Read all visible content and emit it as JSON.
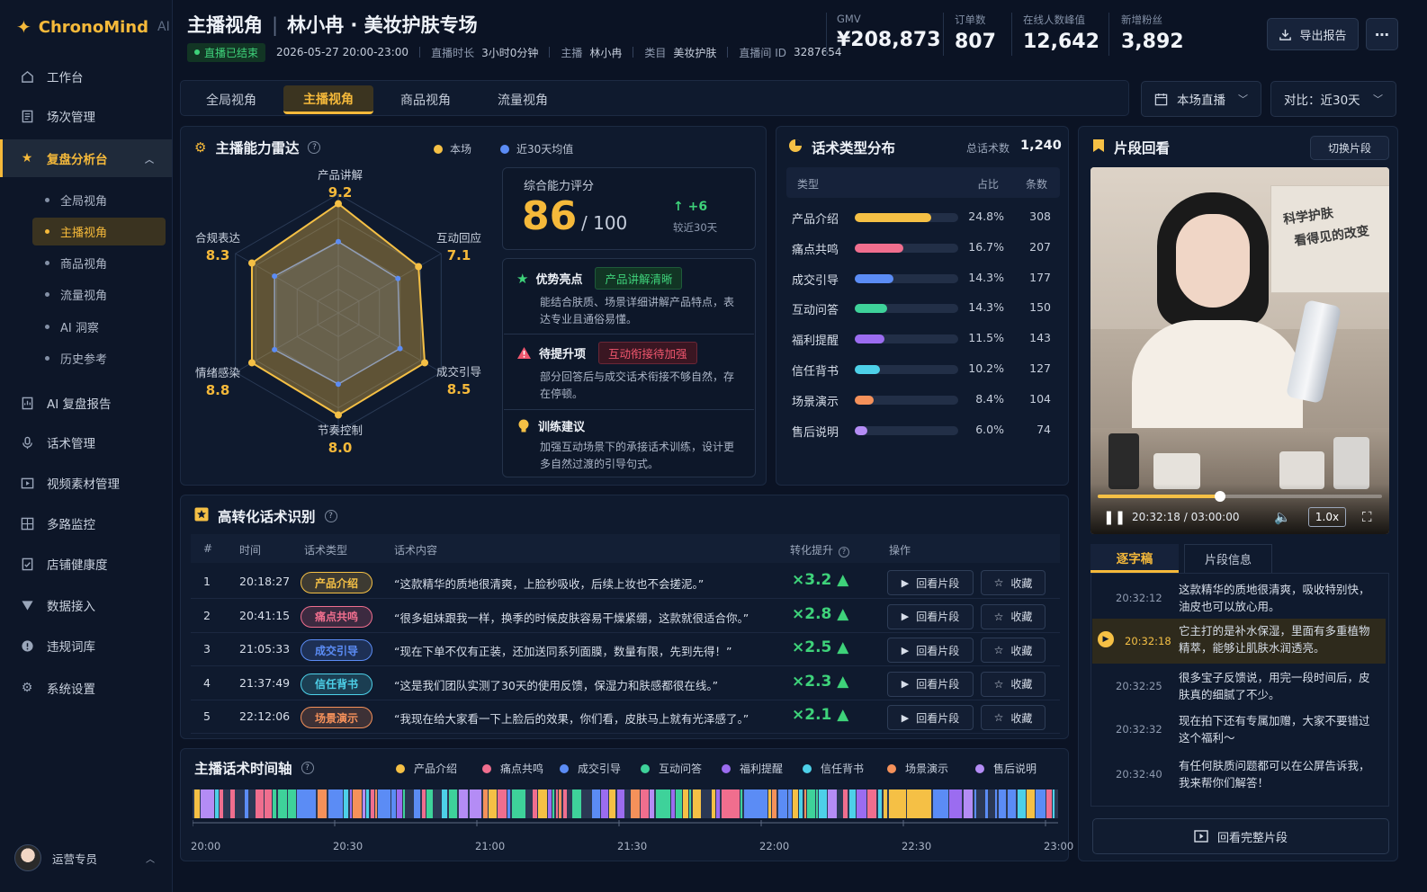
{
  "app": {
    "name": "ChronoMind",
    "suffix": "AI"
  },
  "sidebar": {
    "items": [
      {
        "label": "工作台",
        "icon": "home-icon"
      },
      {
        "label": "场次管理",
        "icon": "list-icon"
      },
      {
        "label": "复盘分析台",
        "icon": "star-icon",
        "active": true
      },
      {
        "label": "AI 复盘报告",
        "icon": "report-icon"
      },
      {
        "label": "话术管理",
        "icon": "mic-icon"
      },
      {
        "label": "视频素材管理",
        "icon": "video-icon"
      },
      {
        "label": "多路监控",
        "icon": "monitor-icon"
      },
      {
        "label": "店铺健康度",
        "icon": "health-icon"
      },
      {
        "label": "数据接入",
        "icon": "funnel-icon"
      },
      {
        "label": "违规词库",
        "icon": "warning-icon"
      },
      {
        "label": "系统设置",
        "icon": "gear-icon"
      }
    ],
    "sub_items": [
      "全局视角",
      "主播视角",
      "商品视角",
      "流量视角",
      "AI 洞察",
      "历史参考"
    ],
    "user": "运营专员"
  },
  "header": {
    "title": "主播视角",
    "subtitle": "林小冉 · 美妆护肤专场",
    "status": "直播已结束",
    "datetime": "2026-05-27  20:00-23:00",
    "duration_label": "直播时长",
    "duration": "3小时0分钟",
    "host_label": "主播",
    "host": "林小冉",
    "category_label": "类目",
    "category": "美妆护肤",
    "room_label": "直播间 ID",
    "room_id": "3287654",
    "kpis": [
      {
        "label": "GMV",
        "value": "¥208,873"
      },
      {
        "label": "订单数",
        "value": "807"
      },
      {
        "label": "在线人数峰值",
        "value": "12,642"
      },
      {
        "label": "新增粉丝",
        "value": "3,892"
      }
    ],
    "export_label": "导出报告",
    "more_label": "⋯"
  },
  "tabs": [
    "全局视角",
    "主播视角",
    "商品视角",
    "流量视角"
  ],
  "filters": {
    "scope": "本场直播",
    "compare": "对比：近30天"
  },
  "radar": {
    "title": "主播能力雷达",
    "legend_current": "本场",
    "legend_avg": "近30天均值",
    "axes": [
      {
        "label": "产品讲解",
        "value": "9.2",
        "score": 9.2,
        "avg": 6.0
      },
      {
        "label": "互动回应",
        "value": "7.1",
        "score": 7.8,
        "avg": 5.8
      },
      {
        "label": "成交引导",
        "value": "8.5",
        "score": 8.4,
        "avg": 6.0
      },
      {
        "label": "节奏控制",
        "value": "8.0",
        "score": 8.6,
        "avg": 6.0
      },
      {
        "label": "情绪感染",
        "value": "8.8",
        "score": 8.4,
        "avg": 6.2
      },
      {
        "label": "合规表达",
        "value": "8.3",
        "score": 8.4,
        "avg": 6.2
      }
    ],
    "score_label": "综合能力评分",
    "score": "86",
    "score_max": "/ 100",
    "delta": "+6",
    "delta_label": "较近30天",
    "insights": [
      {
        "title": "优势亮点",
        "tag": "产品讲解清晰",
        "text": "能结合肤质、场景详细讲解产品特点，表达专业且通俗易懂。"
      },
      {
        "title": "待提升项",
        "tag": "互动衔接待加强",
        "text": "部分回答后与成交话术衔接不够自然，存在停顿。"
      },
      {
        "title": "训练建议",
        "tag": "",
        "text": "加强互动场景下的承接话术训练，设计更多自然过渡的引导句式。"
      }
    ]
  },
  "distribution": {
    "title": "话术类型分布",
    "total_label": "总话术数",
    "total": "1,240",
    "headers": [
      "类型",
      "占比",
      "条数"
    ],
    "rows": [
      {
        "name": "产品介绍",
        "pct": "24.8%",
        "count": "308",
        "fraction": 0.74,
        "color": "#f5c045"
      },
      {
        "name": "痛点共鸣",
        "pct": "16.7%",
        "count": "207",
        "fraction": 0.47,
        "color": "#f06e8e"
      },
      {
        "name": "成交引导",
        "pct": "14.3%",
        "count": "177",
        "fraction": 0.37,
        "color": "#5b8cf5"
      },
      {
        "name": "互动问答",
        "pct": "14.3%",
        "count": "150",
        "fraction": 0.31,
        "color": "#3ed29a"
      },
      {
        "name": "福利提醒",
        "pct": "11.5%",
        "count": "143",
        "fraction": 0.29,
        "color": "#9b6cf0"
      },
      {
        "name": "信任背书",
        "pct": "10.2%",
        "count": "127",
        "fraction": 0.24,
        "color": "#4dd0e8"
      },
      {
        "name": "场景演示",
        "pct": "8.4%",
        "count": "104",
        "fraction": 0.18,
        "color": "#f5915a"
      },
      {
        "name": "售后说明",
        "pct": "6.0%",
        "count": "74",
        "fraction": 0.12,
        "color": "#b48cf5"
      }
    ]
  },
  "clip": {
    "title": "片段回看",
    "switch_label": "切换片段",
    "poster_text_1": "科学护肤",
    "poster_text_2": "看得见的改变",
    "progress": 0.43,
    "time": "20:32:18 / 03:00:00",
    "speed": "1.0x",
    "tabs": [
      "逐字稿",
      "片段信息"
    ],
    "transcript": [
      {
        "time": "20:32:12",
        "text": "这款精华的质地很清爽，吸收特别快，油皮也可以放心用。"
      },
      {
        "time": "20:32:18",
        "text": "它主打的是补水保湿，里面有多重植物精萃，能够让肌肤水润透亮。",
        "active": true
      },
      {
        "time": "20:32:25",
        "text": "很多宝子反馈说，用完一段时间后，皮肤真的细腻了不少。"
      },
      {
        "time": "20:32:32",
        "text": "现在拍下还有专属加赠，大家不要错过这个福利～"
      },
      {
        "time": "20:32:40",
        "text": "有任何肤质问题都可以在公屏告诉我，我来帮你们解答！"
      }
    ],
    "full_label": "回看完整片段"
  },
  "phrases": {
    "title": "高转化话术识别",
    "headers": [
      "#",
      "时间",
      "话术类型",
      "话术内容",
      "转化提升",
      "操作"
    ],
    "rows": [
      {
        "n": "1",
        "time": "20:18:27",
        "type": "产品介绍",
        "color": "#f5c045",
        "text": "“这款精华的质地很清爽，上脸秒吸收，后续上妆也不会搓泥。”",
        "lift": "×3.2 ▲"
      },
      {
        "n": "2",
        "time": "20:41:15",
        "type": "痛点共鸣",
        "color": "#f06e8e",
        "text": "“很多姐妹跟我一样，换季的时候皮肤容易干燥紧绷，这款就很适合你。”",
        "lift": "×2.8 ▲"
      },
      {
        "n": "3",
        "time": "21:05:33",
        "type": "成交引导",
        "color": "#5b8cf5",
        "text": "“现在下单不仅有正装，还加送同系列面膜，数量有限，先到先得！”",
        "lift": "×2.5 ▲"
      },
      {
        "n": "4",
        "time": "21:37:49",
        "type": "信任背书",
        "color": "#4dd0e8",
        "text": "“这是我们团队实测了30天的使用反馈，保湿力和肤感都很在线。”",
        "lift": "×2.3 ▲"
      },
      {
        "n": "5",
        "time": "22:12:06",
        "type": "场景演示",
        "color": "#f5915a",
        "text": "“我现在给大家看一下上脸后的效果，你们看，皮肤马上就有光泽感了。”",
        "lift": "×2.1 ▲"
      }
    ],
    "replay_label": "回看片段",
    "fav_label": "收藏"
  },
  "timeline": {
    "title": "主播话术时间轴",
    "legend": [
      {
        "name": "产品介绍",
        "color": "#f5c045"
      },
      {
        "name": "痛点共鸣",
        "color": "#f06e8e"
      },
      {
        "name": "成交引导",
        "color": "#5b8cf5"
      },
      {
        "name": "互动问答",
        "color": "#3ed29a"
      },
      {
        "name": "福利提醒",
        "color": "#9b6cf0"
      },
      {
        "name": "信任背书",
        "color": "#4dd0e8"
      },
      {
        "name": "场景演示",
        "color": "#f5915a"
      },
      {
        "name": "售后说明",
        "color": "#b48cf5"
      }
    ],
    "ticks": [
      "20:00",
      "20:30",
      "21:00",
      "21:30",
      "22:00",
      "22:30",
      "23:00"
    ]
  }
}
